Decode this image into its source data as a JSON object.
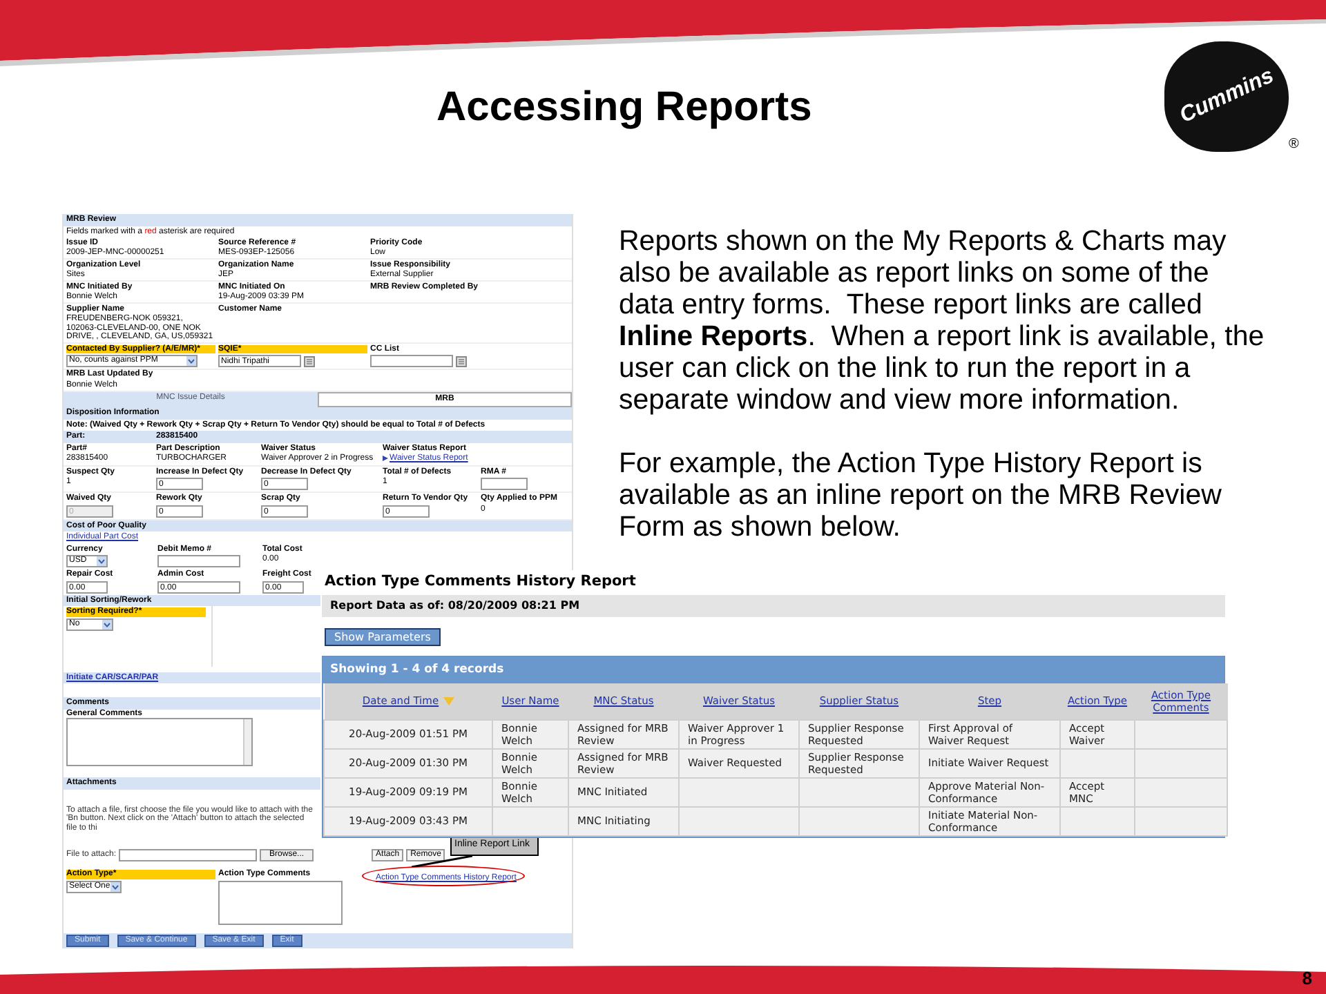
{
  "slide": {
    "title": "Accessing Reports",
    "page_number": "8"
  },
  "logo": {
    "text": "Cummins",
    "mark": "®"
  },
  "form": {
    "title": "MRB Review",
    "note_parts": [
      "Fields marked with a ",
      "red",
      " asterisk are required"
    ],
    "info_rows": [
      [
        {
          "label": "Issue ID",
          "kind": "text",
          "value": "2009-JEP-MNC-00000251"
        },
        {
          "label": "Source Reference #",
          "kind": "text",
          "value": "MES-093EP-125056"
        },
        {
          "label": "Priority Code",
          "kind": "text",
          "value": "Low"
        }
      ],
      [
        {
          "label": "Organization Level",
          "kind": "text",
          "value": "Sites"
        },
        {
          "label": "Organization Name",
          "kind": "text",
          "value": "JEP"
        },
        {
          "label": "Issue Responsibility",
          "kind": "text",
          "value": "External Supplier"
        }
      ],
      [
        {
          "label": "MNC Initiated By",
          "kind": "text",
          "value": "Bonnie Welch"
        },
        {
          "label": "MNC Initiated On",
          "kind": "text",
          "value": "19-Aug-2009 03:39 PM"
        },
        {
          "label": "MRB Review Completed By",
          "kind": "text"
        }
      ],
      [
        {
          "label": "Supplier Name",
          "kind": "text",
          "value": "FREUDENBERG-NOK 059321, 102063-CLEVELAND-00, ONE NOK DRIVE, , CLEVELAND, GA, US,059321"
        },
        {
          "label": "Customer Name",
          "kind": "text"
        }
      ],
      [
        {
          "label": "Contacted By Supplier? (A/E/MR)*",
          "required": true,
          "kind": "select",
          "value": "No, counts against PPM"
        },
        {
          "label": "SQIE*",
          "required": true,
          "kind": "picker",
          "value": "Nidhi Tripathi"
        },
        {
          "label": "CC List",
          "required": false,
          "kind": "picker"
        }
      ],
      [
        {
          "label": "MRB Last Updated By",
          "kind": "text",
          "value": "Bonnie Welch"
        }
      ]
    ],
    "tabs": [
      {
        "label": "MNC Issue Details",
        "selected": false
      },
      {
        "label": "MRB",
        "selected": true
      }
    ],
    "disposition": {
      "title": "Disposition Information",
      "note": "Note: (Waived Qty + Rework Qty + Scrap Qty + Return To Vendor Qty) should be equal to Total # of Defects",
      "part_label": "Part:",
      "part_number": "283815400",
      "rows": [
        [
          {
            "label": "Part#",
            "kind": "text",
            "value": "283815400"
          },
          {
            "label": "Part Description",
            "kind": "text",
            "value": "TURBOCHARGER"
          },
          {
            "label": "Waiver Status",
            "kind": "text",
            "value": "Waiver Approver 2 in Progress"
          },
          {
            "label": "Waiver Status Report",
            "kind": "link",
            "value": "Waiver Status Report"
          }
        ],
        [
          {
            "label": "Suspect Qty",
            "kind": "text",
            "value": "1"
          },
          {
            "label": "Increase In Defect Qty",
            "kind": "input",
            "value": "0",
            "disabled": false
          },
          {
            "label": "Decrease In Defect Qty",
            "kind": "input",
            "value": "0",
            "disabled": false
          },
          {
            "label": "Total # of Defects",
            "kind": "text",
            "value": "1"
          },
          {
            "label": "RMA #",
            "kind": "input",
            "disabled": false
          }
        ],
        [
          {
            "label": "Waived Qty",
            "kind": "input",
            "value": "0",
            "disabled": true
          },
          {
            "label": "Rework Qty",
            "kind": "input",
            "value": "0",
            "disabled": false
          },
          {
            "label": "Scrap Qty",
            "kind": "input",
            "value": "0",
            "disabled": false
          },
          {
            "label": "Return To Vendor Qty",
            "kind": "input",
            "value": "0",
            "disabled": false
          },
          {
            "label": "Qty Applied to PPM",
            "kind": "text",
            "value": "0"
          }
        ]
      ]
    },
    "cost": {
      "title": "Cost of Poor Quality",
      "link": "Individual Part Cost",
      "rows": [
        [
          {
            "label": "Currency",
            "kind": "select",
            "value": "USD"
          },
          {
            "label": "Debit Memo #",
            "kind": "input",
            "disabled": false
          },
          {
            "label": "Total Cost",
            "kind": "text",
            "value": "0.00"
          }
        ],
        [
          {
            "label": "Repair Cost",
            "kind": "input",
            "value": "0.00",
            "disabled": false
          },
          {
            "label": "Admin Cost",
            "kind": "input",
            "value": "0.00",
            "disabled": false
          },
          {
            "label": "Freight Cost",
            "kind": "input",
            "value": "0.00",
            "disabled": false
          }
        ]
      ]
    },
    "sorting": {
      "title": "Initial Sorting/Rework",
      "field": {
        "label": "Sorting Required?*",
        "required": true,
        "kind": "select",
        "value": "No"
      }
    },
    "car_link": "Initiate CAR/SCAR/PAR",
    "comments": {
      "title": "Comments",
      "label": "General Comments"
    },
    "attachments": {
      "title": "Attachments",
      "instructions": "To attach a file, first choose the file you would like to attach with the 'Bn button. Next click on the 'Attach' button to attach the selected file to thi",
      "file_label": "File to attach:",
      "browse_button": "Browse...",
      "buttons": [
        "Attach",
        "Remove"
      ]
    },
    "action": {
      "type_field": {
        "label": "Action Type*",
        "required": true,
        "kind": "select",
        "value": "Select One"
      },
      "comments_label": "Action Type Comments",
      "report_link": "Action Type Comments History Report"
    },
    "buttons": [
      "Submit",
      "Save & Continue",
      "Save & Exit",
      "Exit"
    ]
  },
  "callout": "Inline Report Link",
  "paragraphs": [
    "Reports shown on the My Reports & Charts may also be available as report links on some of the data entry forms.  These report links are called **Inline Reports**.  When a report link is available, the user can click on the link to run the report in a separate window and view more information.",
    "For example, the Action Type History Report is available as an inline report on the MRB Review Form as shown below."
  ],
  "report": {
    "title": "Action Type Comments History Report",
    "data_as_of": "Report Data as of: 08/20/2009 08:21 PM",
    "parameters_button": "Show Parameters",
    "records": "Showing 1 - 4 of 4 records",
    "columns": [
      {
        "label": "Date and Time",
        "sorted": true
      },
      {
        "label": "User Name",
        "sorted": false
      },
      {
        "label": "MNC Status",
        "sorted": false
      },
      {
        "label": "Waiver Status",
        "sorted": false
      },
      {
        "label": "Supplier Status",
        "sorted": false
      },
      {
        "label": "Step",
        "sorted": false
      },
      {
        "label": "Action Type",
        "sorted": false
      },
      {
        "label": "Action Type Comments",
        "sorted": false
      }
    ],
    "rows": [
      [
        "20-Aug-2009 01:51 PM",
        "Bonnie Welch",
        "Assigned for MRB Review",
        "Waiver Approver 1 in Progress",
        "Supplier Response Requested",
        "First Approval of Waiver Request",
        "Accept Waiver",
        ""
      ],
      [
        "20-Aug-2009 01:30 PM",
        "Bonnie Welch",
        "Assigned for MRB Review",
        "Waiver Requested",
        "Supplier Response Requested",
        "Initiate Waiver Request",
        "",
        ""
      ],
      [
        "19-Aug-2009 09:19 PM",
        "Bonnie Welch",
        "MNC Initiated",
        "",
        "",
        "Approve Material Non-Conformance",
        "Accept MNC",
        ""
      ],
      [
        "19-Aug-2009 03:43 PM",
        "",
        "MNC Initiating",
        "",
        "",
        "Initiate Material Non-Conformance",
        "",
        ""
      ]
    ]
  }
}
